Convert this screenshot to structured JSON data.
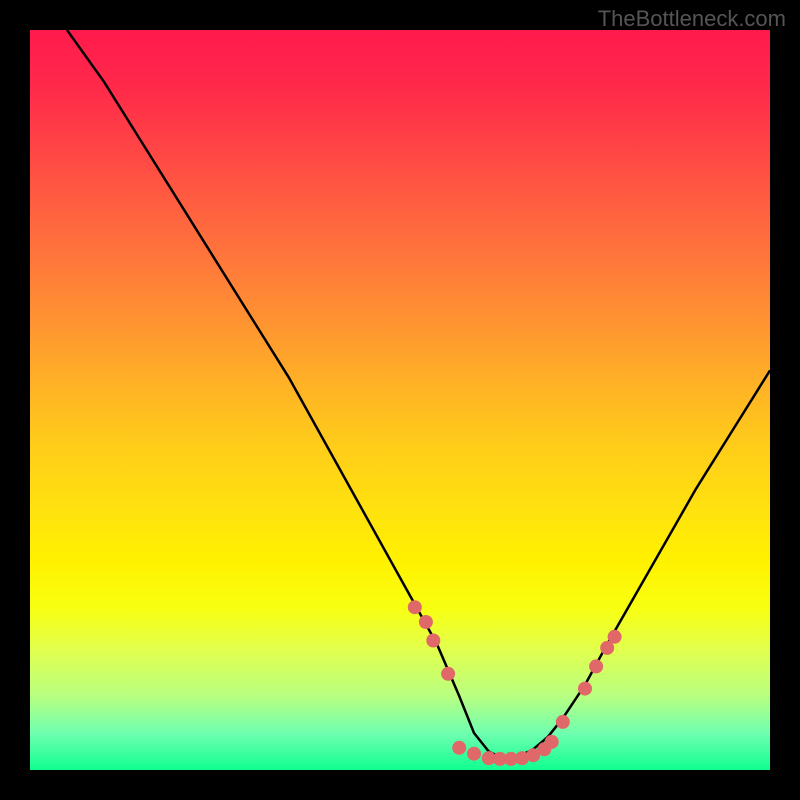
{
  "watermark": "TheBottleneck.com",
  "chart_data": {
    "type": "line",
    "title": "",
    "xlabel": "",
    "ylabel": "",
    "xlim": [
      0,
      100
    ],
    "ylim": [
      0,
      100
    ],
    "curve_left": {
      "name": "left-branch",
      "x": [
        5,
        10,
        15,
        20,
        25,
        30,
        35,
        40,
        45,
        50,
        55,
        58,
        60,
        62,
        64
      ],
      "y": [
        100,
        93,
        85,
        77,
        69,
        61,
        53,
        44,
        35,
        26,
        17,
        10,
        5,
        2.5,
        1.5
      ]
    },
    "curve_right": {
      "name": "right-branch",
      "x": [
        64,
        66,
        68,
        70,
        72,
        75,
        78,
        82,
        86,
        90,
        95,
        100
      ],
      "y": [
        1.5,
        1.8,
        2.8,
        4.5,
        7,
        11.5,
        17,
        24,
        31,
        38,
        46,
        54
      ]
    },
    "dots": {
      "name": "data-points",
      "color": "#e06868",
      "points": [
        {
          "x": 52,
          "y": 22
        },
        {
          "x": 53.5,
          "y": 20
        },
        {
          "x": 54.5,
          "y": 17.5
        },
        {
          "x": 56.5,
          "y": 13
        },
        {
          "x": 58,
          "y": 3
        },
        {
          "x": 60,
          "y": 2.2
        },
        {
          "x": 62,
          "y": 1.6
        },
        {
          "x": 63.5,
          "y": 1.5
        },
        {
          "x": 65,
          "y": 1.5
        },
        {
          "x": 66.5,
          "y": 1.6
        },
        {
          "x": 68,
          "y": 2.0
        },
        {
          "x": 69.5,
          "y": 2.8
        },
        {
          "x": 70.5,
          "y": 3.8
        },
        {
          "x": 72,
          "y": 6.5
        },
        {
          "x": 75,
          "y": 11
        },
        {
          "x": 76.5,
          "y": 14
        },
        {
          "x": 78,
          "y": 16.5
        },
        {
          "x": 79,
          "y": 18
        }
      ]
    }
  }
}
